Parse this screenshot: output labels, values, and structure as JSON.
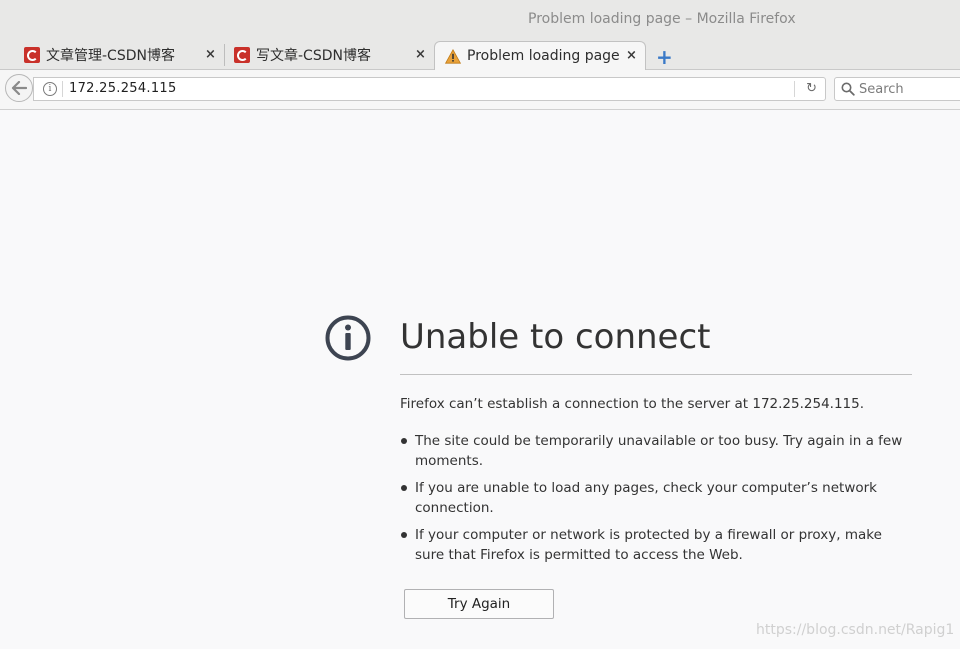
{
  "window": {
    "title": "Problem loading page – Mozilla Firefox"
  },
  "tabs": [
    {
      "label": "文章管理-CSDN博客",
      "icon": "csdn-icon",
      "active": false
    },
    {
      "label": "写文章-CSDN博客",
      "icon": "csdn-icon",
      "active": false
    },
    {
      "label": "Problem loading page",
      "icon": "warning-icon",
      "active": true
    }
  ],
  "tab_close_glyph": "×",
  "new_tab_glyph": "+",
  "nav": {
    "url": "172.25.254.115",
    "search_placeholder": "Search",
    "reload_glyph": "↻",
    "site_info_glyph": "i"
  },
  "error_page": {
    "title": "Unable to connect",
    "message": "Firefox can’t establish a connection to the server at 172.25.254.115.",
    "suggestions": [
      "The site could be temporarily unavailable or too busy. Try again in a few moments.",
      "If you are unable to load any pages, check your computer’s network connection.",
      "If your computer or network is protected by a firewall or proxy, make sure that Firefox is permitted to access the Web."
    ],
    "try_again_label": "Try Again"
  },
  "watermark": "https://blog.csdn.net/Rapig1",
  "colors": {
    "chrome_bg": "#e8e8e7",
    "page_bg": "#f9f9fa",
    "csdn_red": "#c9312a",
    "new_tab_blue": "#3a79c7",
    "warning_orange": "#e8a13a"
  }
}
